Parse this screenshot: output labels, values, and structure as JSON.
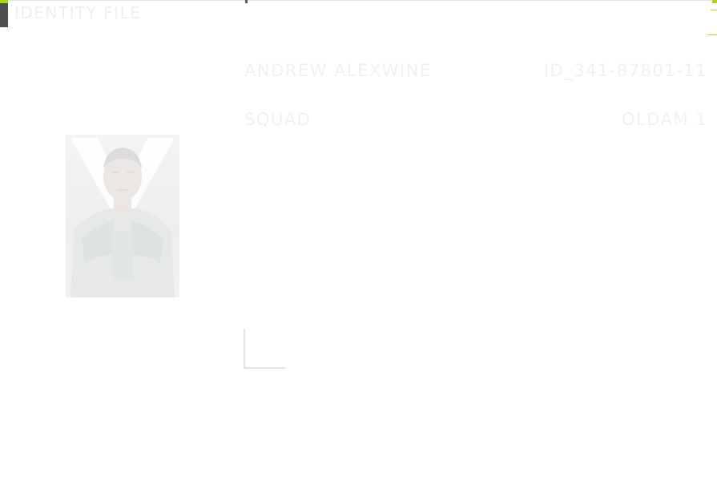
{
  "header": {
    "brand_title": "IDENTITY FILE"
  },
  "profile": {
    "name": "ANDREW ALEXWINE",
    "id_code": "ID_341-87801-11",
    "squad_label": "SQUAD",
    "squad_value": "OLDAM 1"
  },
  "colors": {
    "accent": "#a8d61c",
    "brand_bar": "#4f4f4f",
    "text_faded": "#f1f1f1"
  }
}
